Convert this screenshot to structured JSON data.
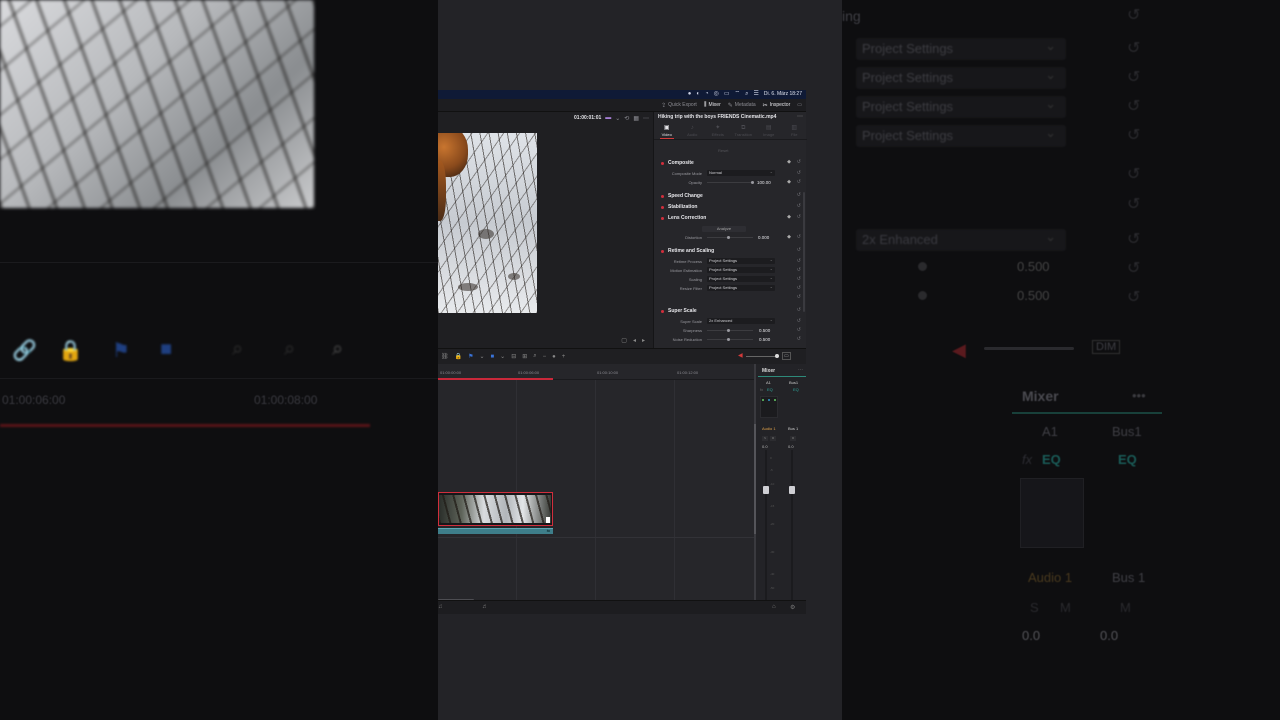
{
  "background_right": {
    "items": [
      "Project Settings",
      "Project Settings",
      "Project Settings",
      "Project Settings"
    ],
    "partial_label": "ing",
    "super_scale": "2x Enhanced",
    "values": [
      "0.500",
      "0.500"
    ],
    "mixer_title": "Mixer",
    "a1": "A1",
    "bus1": "Bus1",
    "fx": "fx",
    "eq1": "EQ",
    "eq2": "EQ",
    "audio1": "Audio 1",
    "bus1b": "Bus 1",
    "zero1": "0.0",
    "zero2": "0.0",
    "s": "S",
    "m": "M",
    "m2": "M",
    "db": "DIM"
  },
  "background_left": {
    "timecode1": "01:00:06:00",
    "timecode2": "01:00:08:00"
  },
  "menubar": {
    "datetime": "Di. 6. März  18:27"
  },
  "pages": {
    "quick_export": "Quick Export",
    "mixer": "Mixer",
    "metadata": "Metadata",
    "inspector": "Inspector"
  },
  "viewer": {
    "timecode": "01:00:01:01"
  },
  "inspector": {
    "clip_title": "Hiking trip with the boys  FRIENDS Cinematic.mp4",
    "tabs": [
      "Video",
      "Audio",
      "Effects",
      "Transition",
      "Image",
      "File"
    ],
    "reset_label": "Reset",
    "composite": {
      "title": "Composite",
      "mode_label": "Composite Mode",
      "mode_value": "Normal",
      "opacity_label": "Opacity",
      "opacity_value": "100.00"
    },
    "speed_change": "Speed Change",
    "stabilization": "Stabilization",
    "lens_correction": {
      "title": "Lens Correction",
      "analyze": "Analyze",
      "distortion_label": "Distortion",
      "distortion_value": "0.000"
    },
    "retime": {
      "title": "Retime and Scaling",
      "process_label": "Retime Process",
      "process_value": "Project Settings",
      "motion_label": "Motion Estimation",
      "motion_value": "Project Settings",
      "scaling_label": "Scaling",
      "scaling_value": "Project Settings",
      "resize_label": "Resize Filter",
      "resize_value": "Project Settings"
    },
    "super_scale": {
      "title": "Super Scale",
      "scale_label": "Super Scale",
      "scale_value": "2x Enhanced",
      "sharpness_label": "Sharpness",
      "sharpness_value": "0.500",
      "noise_label": "Noise Reduction",
      "noise_value": "0.500"
    }
  },
  "timeline": {
    "ruler": [
      "01:00:00:00",
      "01:00:06:00",
      "01:00:10:00",
      "01:00:12:00"
    ]
  },
  "mixer": {
    "title": "Mixer",
    "a1": "A1",
    "bus1": "Bus1",
    "fx": "fx",
    "eq": "EQ",
    "eq2": "EQ",
    "audio1": "Audio 1",
    "bus1b": "Bus 1",
    "s": "S",
    "m": "M",
    "m2": "M",
    "zero1": "0.0",
    "zero2": "0.0",
    "scale": [
      "0",
      "-5",
      "-10",
      "-15",
      "-20",
      "-30",
      "-40",
      "-50"
    ]
  }
}
